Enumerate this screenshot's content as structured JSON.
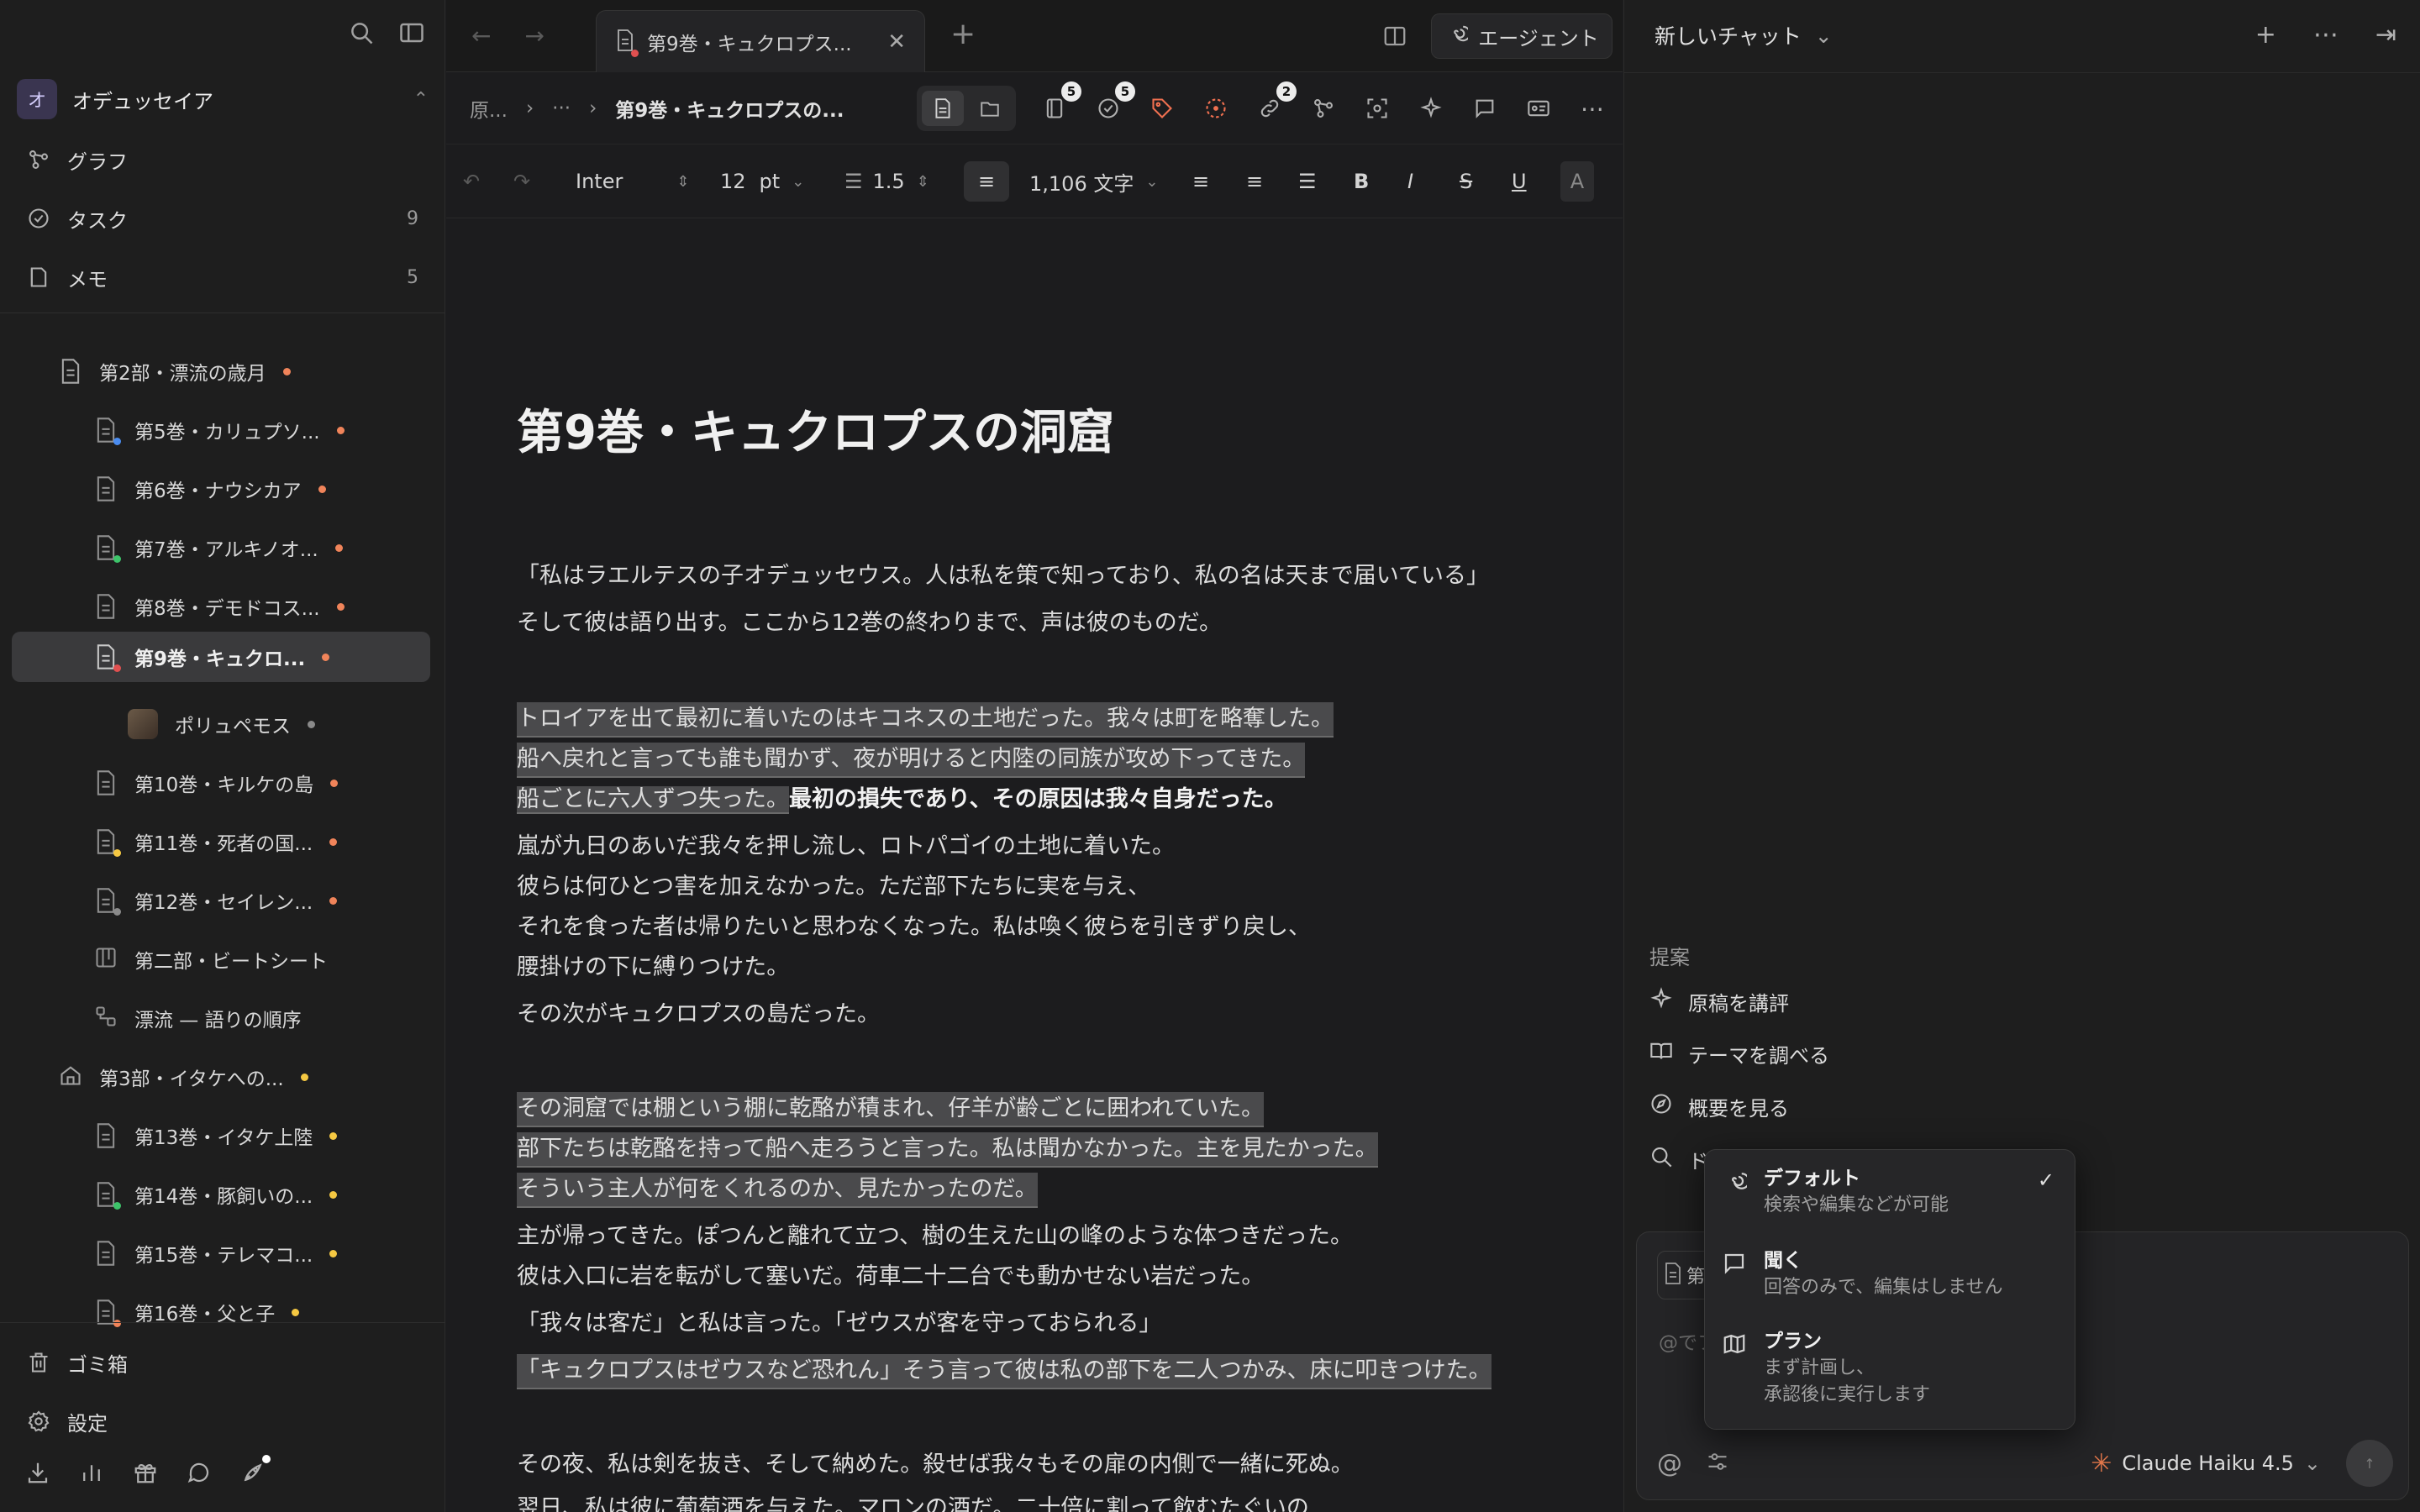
{
  "sidebar": {
    "workspace": {
      "initial": "オ",
      "name": "オデュッセイア"
    },
    "nav": [
      {
        "label": "グラフ",
        "count": ""
      },
      {
        "label": "タスク",
        "count": "9"
      },
      {
        "label": "メモ",
        "count": "5"
      }
    ],
    "tree": [
      {
        "label": "第2部・漂流の歳月",
        "dot": "#f0845a"
      },
      {
        "label": "第5巻・カリュプソ...",
        "dot": "#f0845a"
      },
      {
        "label": "第6巻・ナウシカア",
        "dot": "#f0845a"
      },
      {
        "label": "第7巻・アルキノオ...",
        "dot": "#f0845a"
      },
      {
        "label": "第8巻・デモドコス...",
        "dot": "#f0845a"
      },
      {
        "label": "第9巻・キュクロ...",
        "dot": "#f0845a"
      },
      {
        "label": "ポリュペモス",
        "dot": "#8a8a8a"
      },
      {
        "label": "第10巻・キルケの島",
        "dot": "#f0845a"
      },
      {
        "label": "第11巻・死者の国...",
        "dot": "#f0845a"
      },
      {
        "label": "第12巻・セイレン...",
        "dot": "#f0845a"
      },
      {
        "label": "第二部・ビートシート",
        "dot": ""
      },
      {
        "label": "漂流 — 語りの順序",
        "dot": ""
      },
      {
        "label": "第3部・イタケへの...",
        "dot": "#f5c842"
      },
      {
        "label": "第13巻・イタケ上陸",
        "dot": "#f5c842"
      },
      {
        "label": "第14巻・豚飼いの...",
        "dot": "#f5c842"
      },
      {
        "label": "第15巻・テレマコ...",
        "dot": "#f5c842"
      },
      {
        "label": "第16巻・父と子",
        "dot": "#f5c842"
      }
    ],
    "footer": [
      {
        "label": "ゴミ箱"
      },
      {
        "label": "設定"
      }
    ]
  },
  "editor": {
    "tab_title": "第9巻・キュクロプス...",
    "agent_label": "エージェント",
    "breadcrumb": {
      "root": "原...",
      "ellipsis": "···",
      "current": "第9巻・キュクロプスの..."
    },
    "badges": {
      "files": "5",
      "tasks": "5",
      "links": "2"
    },
    "format": {
      "font": "Inter",
      "size": "12",
      "unit": "pt",
      "line_height": "1.5",
      "word_count": "1,106 文字"
    },
    "title": "第9巻・キュクロプスの洞窟",
    "lines": [
      "「私はラエルテスの子オデュッセウス。人は私を策で知っており、私の名は天まで届いている」",
      "そして彼は語り出す。ここから12巻の終わりまで、声は彼のものだ。",
      "トロイアを出て最初に着いたのはキコネスの土地だった。我々は町を略奪した。",
      "船へ戻れと言っても誰も聞かず、夜が明けると内陸の同族が攻め下ってきた。",
      "船ごとに六人ずつ失った。",
      "最初の損失であり、その原因は我々自身だった。",
      "嵐が九日のあいだ我々を押し流し、ロトパゴイの土地に着いた。",
      "彼らは何ひとつ害を加えなかった。ただ部下たちに実を与え、",
      "それを食った者は帰りたいと思わなくなった。私は喚く彼らを引きずり戻し、",
      "腰掛けの下に縛りつけた。",
      "その次がキュクロプスの島だった。",
      "その洞窟では棚という棚に乾酪が積まれ、仔羊が齢ごとに囲われていた。",
      "部下たちは乾酪を持って船へ走ろうと言った。私は聞かなかった。主を見たかった。",
      "そういう主人が何をくれるのか、見たかったのだ。",
      "主が帰ってきた。ぽつんと離れて立つ、樹の生えた山の峰のような体つきだった。",
      "彼は入口に岩を転がして塞いだ。荷車二十二台でも動かせない岩だった。",
      "「我々は客だ」と私は言った。「ゼウスが客を守っておられる」",
      "「キュクロプスはゼウスなど恐れん」そう言って彼は私の部下を二人つかみ、床に叩きつけた。",
      "その夜、私は剣を抜き、そして納めた。殺せば我々もその扉の内側で一緒に死ぬ。",
      "翌日、私は彼に葡萄酒を与えた。マロンの酒だ。二十倍に割って飲むたぐいの"
    ]
  },
  "chat": {
    "title": "新しいチャット",
    "suggestions_title": "提案",
    "suggestions": [
      "原稿を講評",
      "テーマを調べる",
      "概要を見る",
      "ド"
    ],
    "placeholder": "@でフ",
    "chip_peek": "第",
    "model": "Claude Haiku 4.5",
    "modes": [
      {
        "name": "デフォルト",
        "desc": "検索や編集などが可能",
        "desc2": ""
      },
      {
        "name": "聞く",
        "desc": "回答のみで、編集はしません",
        "desc2": ""
      },
      {
        "name": "プラン",
        "desc": "まず計画し、",
        "desc2": "承認後に実行します"
      }
    ]
  }
}
